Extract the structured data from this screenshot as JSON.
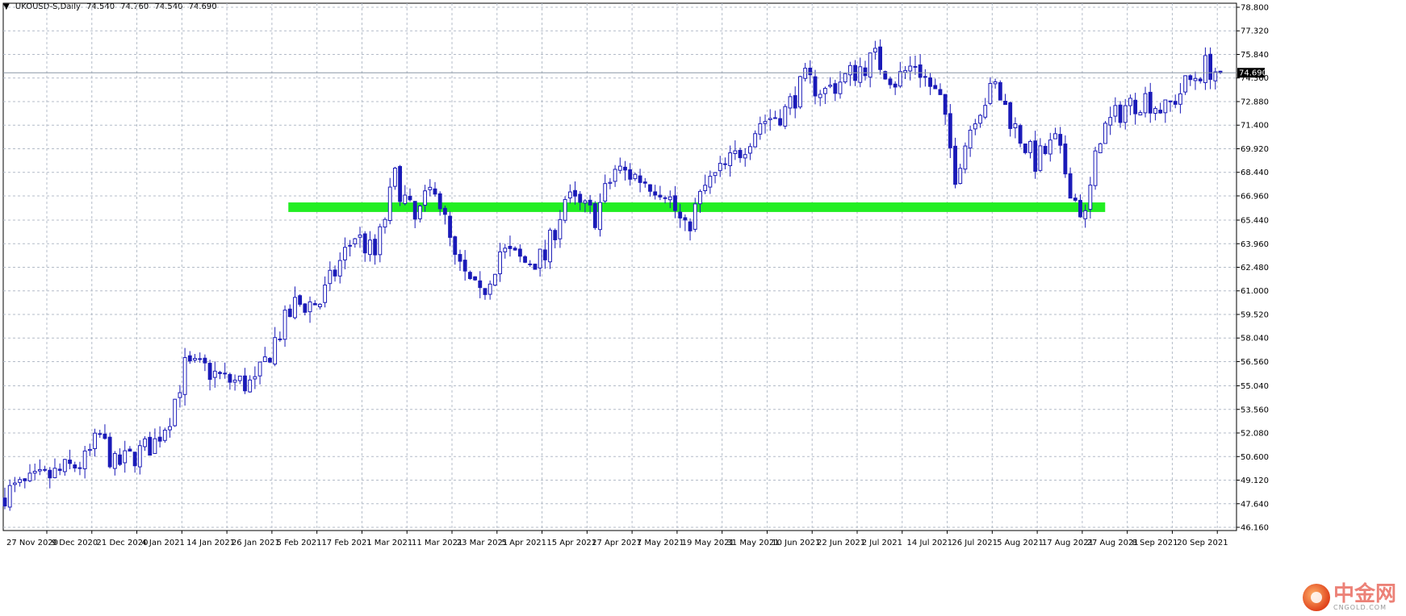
{
  "header": {
    "symbol": "UKOUSD-S,Daily",
    "open": "74.540",
    "high": "74.760",
    "low": "74.540",
    "close": "74.690"
  },
  "watermark": {
    "cn": "中金网",
    "en": "CNGOLD.COM"
  },
  "colors": {
    "bull": "#ffffff",
    "bear": "#1a1ab8",
    "outline": "#1a1ab8",
    "grid": "#b4bcc8",
    "support_zone": "#22ee22",
    "price_line": "#8a97a6",
    "price_label_bg": "#000000"
  },
  "chart_data": {
    "type": "candlestick",
    "ylim": [
      46.16,
      78.8
    ],
    "price_label": "74.690",
    "current_price": 74.69,
    "grid": true,
    "y_ticks": [
      "78.800",
      "77.320",
      "75.840",
      "74.360",
      "72.880",
      "71.400",
      "69.920",
      "68.440",
      "66.960",
      "65.440",
      "63.960",
      "62.480",
      "61.000",
      "59.520",
      "58.040",
      "56.560",
      "55.040",
      "53.560",
      "52.080",
      "50.600",
      "49.120",
      "47.640",
      "46.160"
    ],
    "x_ticks": [
      "27 Nov 2020",
      "9 Dec 2020",
      "21 Dec 2020",
      "4 Jan 2021",
      "14 Jan 2021",
      "26 Jan 2021",
      "5 Feb 2021",
      "17 Feb 2021",
      "1 Mar 2021",
      "11 Mar 2021",
      "23 Mar 2021",
      "5 Apr 2021",
      "15 Apr 2021",
      "27 Apr 2021",
      "7 May 2021",
      "19 May 2021",
      "31 May 2021",
      "10 Jun 2021",
      "22 Jun 2021",
      "2 Jul 2021",
      "14 Jul 2021",
      "26 Jul 2021",
      "5 Aug 2021",
      "17 Aug 2021",
      "27 Aug 2021",
      "8 Sep 2021",
      "20 Sep 2021"
    ],
    "support_zone": {
      "from_index": 57,
      "to_index": 219,
      "low": 65.95,
      "high": 66.55
    },
    "close_path": [
      [
        0,
        48.3
      ],
      [
        6,
        49.0
      ],
      [
        10,
        49.5
      ],
      [
        16,
        50.3
      ],
      [
        19,
        51.9
      ],
      [
        22,
        50.0
      ],
      [
        26,
        50.7
      ],
      [
        30,
        51.5
      ],
      [
        33,
        53.2
      ],
      [
        36,
        56.2
      ],
      [
        40,
        56.1
      ],
      [
        44,
        55.4
      ],
      [
        50,
        55.1
      ],
      [
        54,
        57.9
      ],
      [
        58,
        60.1
      ],
      [
        63,
        60.3
      ],
      [
        67,
        62.8
      ],
      [
        70,
        64.5
      ],
      [
        74,
        63.2
      ],
      [
        78,
        68.1
      ],
      [
        82,
        65.3
      ],
      [
        86,
        67.8
      ],
      [
        90,
        62.8
      ],
      [
        95,
        60.5
      ],
      [
        99,
        63.5
      ],
      [
        104,
        62.8
      ],
      [
        108,
        63.1
      ],
      [
        112,
        66.8
      ],
      [
        118,
        65.7
      ],
      [
        122,
        68.6
      ],
      [
        126,
        68.2
      ],
      [
        132,
        67.4
      ],
      [
        136,
        64.7
      ],
      [
        140,
        67.5
      ],
      [
        146,
        69.4
      ],
      [
        151,
        71.6
      ],
      [
        156,
        72.3
      ],
      [
        160,
        74.2
      ],
      [
        164,
        73.5
      ],
      [
        169,
        74.6
      ],
      [
        174,
        75.6
      ],
      [
        178,
        74.2
      ],
      [
        182,
        75.3
      ],
      [
        187,
        72.9
      ],
      [
        190,
        68.4
      ],
      [
        194,
        72.2
      ],
      [
        198,
        73.8
      ],
      [
        202,
        71.2
      ],
      [
        206,
        69.1
      ],
      [
        210,
        70.3
      ],
      [
        214,
        66.7
      ],
      [
        216,
        65.6
      ],
      [
        219,
        70.9
      ],
      [
        224,
        72.6
      ],
      [
        228,
        73.1
      ],
      [
        232,
        72.3
      ],
      [
        236,
        73.9
      ],
      [
        240,
        75.1
      ],
      [
        243,
        74.69
      ]
    ],
    "candle_count": 244,
    "seed": 7
  }
}
